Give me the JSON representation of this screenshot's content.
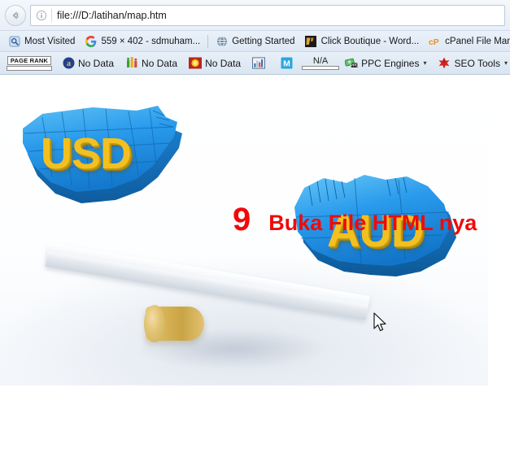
{
  "browser": {
    "back_button": "back-arrow",
    "identity_icon": "info-icon",
    "url": "file:///D:/latihan/map.htm"
  },
  "bookmarks": [
    {
      "label": "Most Visited",
      "icon": "most-visited-icon"
    },
    {
      "label": "559 × 402 - sdmuham...",
      "icon": "google-icon"
    },
    {
      "label": "Getting Started",
      "icon": "globe-icon"
    },
    {
      "label": "Click Boutique - Word...",
      "icon": "wordpress-icon"
    },
    {
      "label": "cPanel File Mana",
      "icon": "cpanel-icon"
    }
  ],
  "seo_toolbar": {
    "pagerank": {
      "label": "PAGE RANK",
      "value": ""
    },
    "items": [
      {
        "label": "No Data",
        "icon": "alexa-icon"
      },
      {
        "label": "No Data",
        "icon": "compete-icon"
      },
      {
        "label": "No Data",
        "icon": "sun-icon"
      },
      {
        "label": "",
        "icon": "chart-icon"
      },
      {
        "label": "",
        "icon": "majestic-m-icon"
      }
    ],
    "na_widget": {
      "label": "N/A"
    },
    "ppc_engines": {
      "label": "PPC Engines",
      "icon": "money-ppc-icon",
      "caret": "▾"
    },
    "seo_tools": {
      "label": "SEO Tools",
      "icon": "red-star-icon",
      "caret": "▾"
    }
  },
  "content": {
    "usd_label": "USD",
    "aud_label": "AUD",
    "annotation_number": "9",
    "annotation_text": "Buka File HTML nya",
    "cursor": "mouse-pointer",
    "colors": {
      "annotation_red": "#f00a0a",
      "map_blue": "#2a9bec",
      "map_blue_dark": "#1572c4",
      "label_gold": "#f2c020",
      "fulcrum_gold": "#d9b559"
    }
  }
}
